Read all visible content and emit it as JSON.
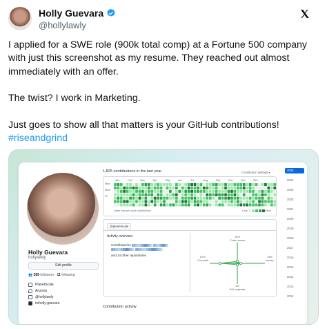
{
  "tweet": {
    "display_name": "Holly Guevara",
    "handle": "@hollylawly",
    "body_lines": [
      "I applied for a SWE role (900k total comp) at a Fortune 500 company",
      "with just this screenshot as my resume. They reached out almost",
      "immediately with an offer."
    ],
    "twist": "The twist? I work in Marketing.",
    "closing": "Just goes to show all that matters is your GitHub contributions!",
    "hashtag": "#riseandgrind"
  },
  "colors": {
    "verified": "#1d9bf0",
    "hashtag": "#1d9bf0",
    "contrib_levels": [
      "#ebedf0",
      "#9be9a8",
      "#40c463",
      "#30a14e",
      "#216e39"
    ],
    "year_active": "#0969da"
  },
  "profile": {
    "name": "Holly Guevara",
    "username": "hollylawly",
    "edit_button": "Edit profile",
    "followers_count": "289",
    "followers_label": "followers",
    "following_count": "11",
    "following_label": "following",
    "meta": [
      {
        "icon": "organization-icon",
        "text": "PlanetScale"
      },
      {
        "icon": "location-icon",
        "text": "Arizona"
      },
      {
        "icon": "x-icon",
        "text": "@hollylawly"
      },
      {
        "icon": "linkedin-icon",
        "text": "in/holly-guevara"
      }
    ]
  },
  "contributions": {
    "title": "1,825 contributions in the last year",
    "settings": "Contribution settings",
    "months": [
      "Jan",
      "Feb",
      "Mar",
      "Apr",
      "May",
      "Jun",
      "Jul",
      "Aug",
      "Sep",
      "Oct",
      "Nov",
      "Dec"
    ],
    "days": [
      "Mon",
      "Wed",
      "Fri"
    ],
    "learn_more": "Learn how we count contributions",
    "less": "Less",
    "more": "More",
    "years": [
      "2025",
      "2024",
      "2023",
      "2022",
      "2021",
      "2020",
      "2019",
      "2018",
      "2017",
      "2016",
      "2015",
      "2014",
      "2013",
      "2012"
    ],
    "active_year": "2025"
  },
  "activity": {
    "org_chip": "@planetscale",
    "overview_title": "Activity overview",
    "contributed_prefix": "Contributed to",
    "others": "and 14 other repositories",
    "radar": {
      "code_review_pct": "10%",
      "code_review_label": "Code review",
      "commits_pct": "87%",
      "commits_label": "Commits",
      "issues_pct": "13%",
      "issues_label": "Issues",
      "pull_requests_pct": "4%",
      "pull_requests_label": "Pull requests"
    },
    "contribution_activity": "Contribution activity"
  }
}
